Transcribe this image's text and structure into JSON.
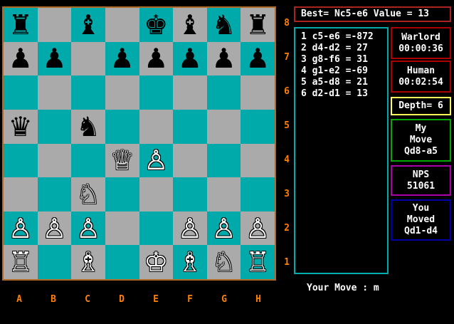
{
  "board": {
    "squares": [
      [
        "♜",
        "",
        "♝",
        "",
        "♚",
        "♝",
        "♞",
        "♜"
      ],
      [
        "♟",
        "♟",
        "",
        "♟",
        "♟",
        "♟",
        "♟",
        "♟"
      ],
      [
        "",
        "",
        "",
        "",
        "",
        "",
        "",
        ""
      ],
      [
        "♛",
        "",
        "♞",
        "",
        "",
        "",
        "",
        ""
      ],
      [
        "",
        "",
        "",
        "♕",
        "♙",
        "",
        "",
        ""
      ],
      [
        "",
        "",
        "♘",
        "",
        "",
        "",
        "",
        ""
      ],
      [
        "♙",
        "♙",
        "♙",
        "",
        "",
        "♙",
        "♙",
        "♙"
      ],
      [
        "♖",
        "",
        "♗",
        "",
        "♔",
        "♗",
        "♘",
        "♖"
      ]
    ],
    "colors": [
      [
        "b",
        "",
        "b",
        "",
        "b",
        "b",
        "b",
        "b"
      ],
      [
        "b",
        "b",
        "",
        "b",
        "b",
        "b",
        "b",
        "b"
      ],
      [
        "",
        "",
        "",
        "",
        "",
        "",
        "",
        ""
      ],
      [
        "b",
        "",
        "b",
        "",
        "",
        "",
        "",
        ""
      ],
      [
        "",
        "",
        "",
        "w",
        "w",
        "",
        "",
        ""
      ],
      [
        "",
        "",
        "w",
        "",
        "",
        "",
        "",
        ""
      ],
      [
        "w",
        "w",
        "w",
        "",
        "",
        "w",
        "w",
        "w"
      ],
      [
        "w",
        "",
        "w",
        "",
        "w",
        "w",
        "w",
        "w"
      ]
    ],
    "ranks": [
      "8",
      "7",
      "6",
      "5",
      "4",
      "3",
      "2",
      "1"
    ],
    "files": [
      "A",
      "B",
      "C",
      "D",
      "E",
      "F",
      "G",
      "H"
    ],
    "light_color": "#00aaaa",
    "dark_color": "#aaaaaa",
    "border_color": "#b06a28"
  },
  "best_line": "Best= Nc5-e6 Value = 13",
  "moves": [
    "1 c5-e6 =-872",
    "2 d4-d2 = 27",
    "3 g8-f6 = 31",
    "4 g1-e2 =-69",
    "5 a5-d8 = 21",
    "6 d2-d1 = 13"
  ],
  "panels": {
    "warlord": {
      "name": "Warlord",
      "time": "00:00:36",
      "color": "#aa0000"
    },
    "human": {
      "name": "Human",
      "time": "00:02:54",
      "color": "#aa0000"
    },
    "depth": {
      "text": "Depth= 6",
      "color": "#ffff55"
    },
    "my_move": {
      "line1": "My",
      "line2": "Move",
      "line3": "Qd8-a5",
      "color": "#00aa00"
    },
    "nps": {
      "line1": "NPS",
      "line2": "51061",
      "color": "#aa00aa"
    },
    "you_moved": {
      "line1": "You",
      "line2": "Moved",
      "line3": "Qd1-d4",
      "color": "#0000aa"
    }
  },
  "your_move": "Your Move : m"
}
